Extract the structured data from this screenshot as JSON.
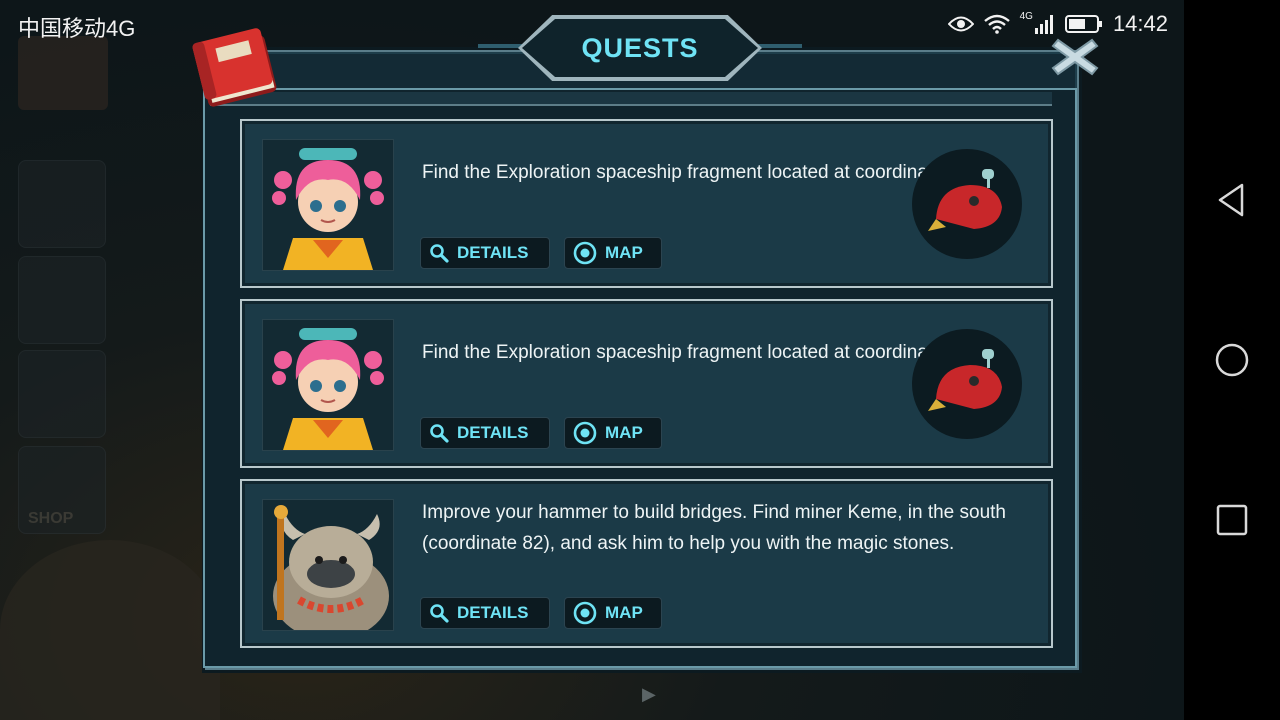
{
  "status_bar": {
    "carrier": "中国移动4G",
    "network": "4G",
    "time": "14:42"
  },
  "panel": {
    "title": "QUESTS"
  },
  "quests": [
    {
      "text": "Find the Exploration spaceship fragment located at coordinate 53.",
      "details_label": "DETAILS",
      "map_label": "MAP",
      "portrait": "pink-haired-girl",
      "reward": "red-spaceship-fragment"
    },
    {
      "text": "Find the Exploration spaceship fragment located at coordinate 37.",
      "details_label": "DETAILS",
      "map_label": "MAP",
      "portrait": "pink-haired-girl",
      "reward": "red-spaceship-fragment"
    },
    {
      "text": "Improve your hammer to build bridges. Find miner Keme, in the south (coordinate 82), and ask him to help you with the magic stones.",
      "details_label": "DETAILS",
      "map_label": "MAP",
      "portrait": "furry-miner-keme"
    }
  ],
  "background": {
    "shop_label": "SHOP"
  },
  "colors": {
    "accent": "#6fe3f5",
    "panel_bg": "#132a35",
    "card_bg": "#1b3a47",
    "button_bg": "#0c1a20"
  }
}
